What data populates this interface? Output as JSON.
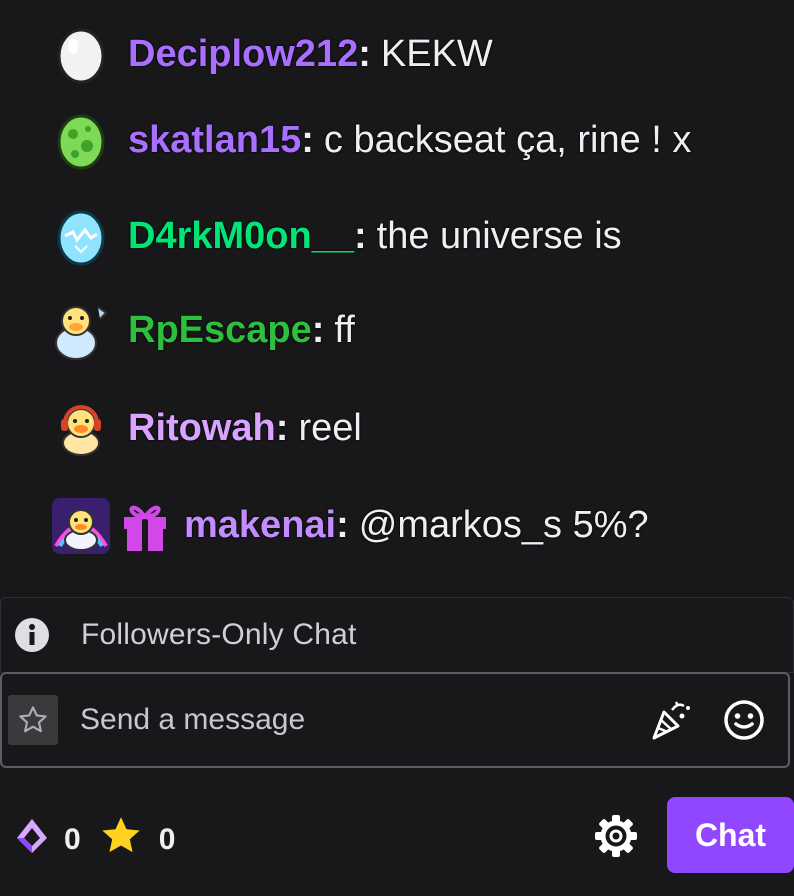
{
  "messages": [
    {
      "badge": "white-egg-badge-icon",
      "user": "Deciplow212",
      "color": "#a970ff",
      "text": "KEKW"
    },
    {
      "badge": "green-egg-badge-icon",
      "user": "skatlan15",
      "color": "#a970ff",
      "text": "c backseat ça, rine ! x"
    },
    {
      "badge": "cracked-blue-egg-badge-icon",
      "user": "D4rkM0on__",
      "color": "#00e676",
      "text": "the universe is"
    },
    {
      "badge": "hatching-duck-badge-icon",
      "user": "RpEscape",
      "color": "#2fbf3f",
      "text": "ff"
    },
    {
      "badge": "headphones-duck-badge-icon",
      "user": "Ritowah",
      "color": "#d9a3ff",
      "text": "reel"
    },
    {
      "badge": "rainbow-duck-badge-icon",
      "gift_badge": "gift-badge-icon",
      "user": "makenai",
      "color": "#c38cff",
      "text": "@markos_s 5%?"
    }
  ],
  "notice": {
    "icon": "info-icon",
    "text": "Followers-Only Chat"
  },
  "input": {
    "placeholder": "Send a message",
    "star_icon": "star-outline-icon",
    "party_icon": "party-popper-icon",
    "emote_icon": "smiley-icon"
  },
  "footer": {
    "channel_points": "0",
    "channel_points_icon": "channel-points-icon",
    "stars": "0",
    "stars_icon": "star-icon",
    "settings_icon": "gear-icon",
    "chat_button": "Chat"
  },
  "colors": {
    "background": "#18181b",
    "accent": "#9146ff"
  }
}
